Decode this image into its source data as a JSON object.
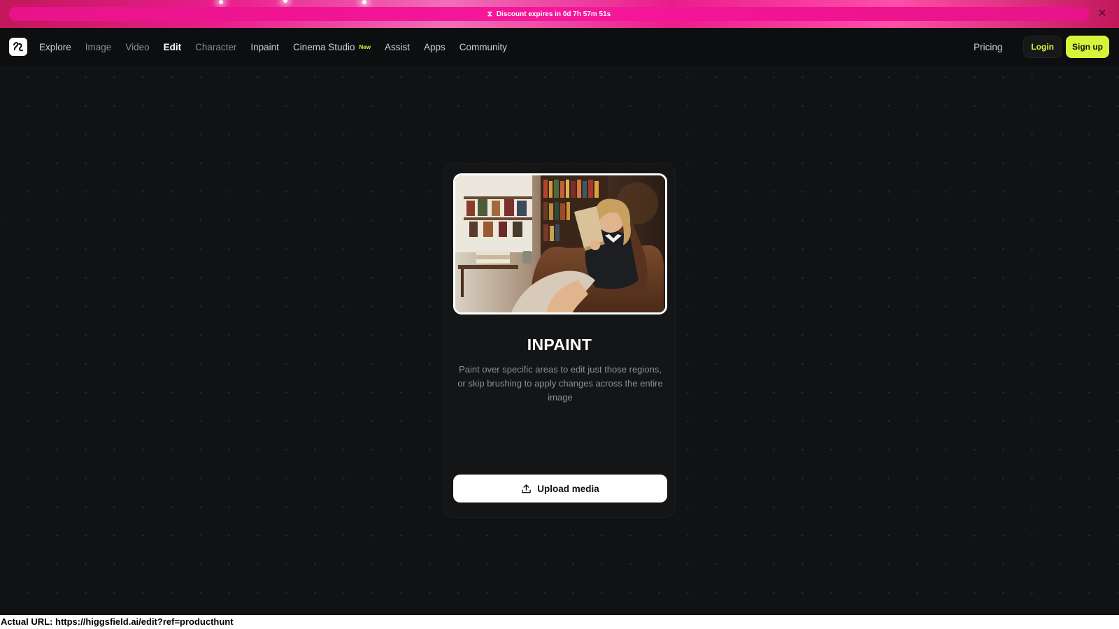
{
  "promo": {
    "text": "Discount expires in 0d 7h 57m 51s",
    "icon": "hourglass-icon",
    "close_icon": "close-icon"
  },
  "nav": {
    "logo": "higgsfield-logo",
    "links": [
      {
        "label": "Explore"
      },
      {
        "label": "Image"
      },
      {
        "label": "Video"
      },
      {
        "label": "Edit"
      },
      {
        "label": "Character"
      },
      {
        "label": "Inpaint"
      },
      {
        "label": "Cinema Studio",
        "badge": "New"
      },
      {
        "label": "Assist"
      },
      {
        "label": "Apps"
      },
      {
        "label": "Community"
      }
    ],
    "active": "Edit",
    "pricing": "Pricing",
    "login": "Login",
    "signup": "Sign up"
  },
  "card": {
    "title": "INPAINT",
    "description": "Paint over specific areas to edit just those regions, or skip brushing to apply changes across the entire image",
    "upload_label": "Upload media",
    "upload_icon": "upload-icon"
  },
  "status": {
    "url_text": "Actual URL: https://higgsfield.ai/edit?ref=producthunt"
  },
  "colors": {
    "accent": "#d6f43a",
    "promo": "#f7169b",
    "background": "#111214"
  }
}
